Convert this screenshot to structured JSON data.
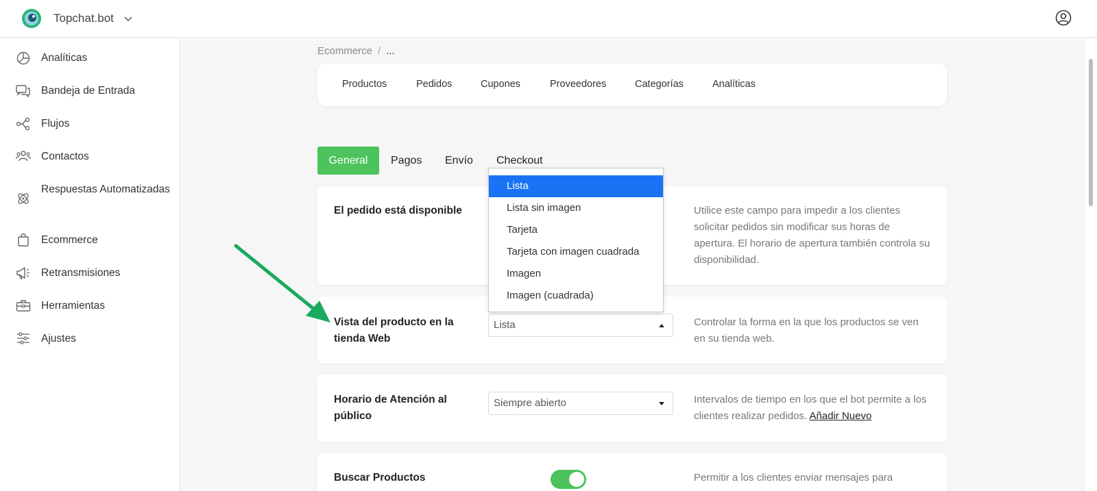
{
  "app": {
    "brand": "Topchat.bot"
  },
  "sidebar": {
    "items": [
      {
        "label": "Analíticas",
        "icon": "pie-chart-icon"
      },
      {
        "label": "Bandeja de Entrada",
        "icon": "chat-bubbles-icon"
      },
      {
        "label": "Flujos",
        "icon": "flow-nodes-icon"
      },
      {
        "label": "Contactos",
        "icon": "people-icon"
      },
      {
        "label": "Respuestas Automatizadas",
        "icon": "atom-icon"
      },
      {
        "label": "Ecommerce",
        "icon": "shopping-bag-icon"
      },
      {
        "label": "Retransmisiones",
        "icon": "megaphone-icon"
      },
      {
        "label": "Herramientas",
        "icon": "toolbox-icon"
      },
      {
        "label": "Ajustes",
        "icon": "sliders-icon"
      }
    ]
  },
  "breadcrumb": {
    "root": "Ecommerce",
    "separator": "/",
    "current": "..."
  },
  "toptabs": [
    "Productos",
    "Pedidos",
    "Cupones",
    "Proveedores",
    "Categorías",
    "Analíticas"
  ],
  "subtabs": {
    "items": [
      "General",
      "Pagos",
      "Envío",
      "Checkout"
    ],
    "active": "General"
  },
  "settings": {
    "order_available": {
      "label": "El pedido está disponible",
      "description": "Utilice este campo para impedir a los clientes solicitar pedidos sin modificar sus horas de apertura. El horario de apertura también controla su disponibilidad."
    },
    "product_view": {
      "label": "Vista del producto en la tienda Web",
      "value": "Lista",
      "description": "Controlar la forma en la que los productos se ven en su tienda web.",
      "options": [
        "Lista",
        "Lista sin imagen",
        "Tarjeta",
        "Tarjeta con imagen cuadrada",
        "Imagen",
        "Imagen (cuadrada)"
      ],
      "selected_option": "Lista"
    },
    "hours": {
      "label": "Horario de Atención al público",
      "value": "Siempre abierto",
      "description": "Intervalos de tiempo en los que el bot permite a los clientes realizar pedidos.",
      "link": "Añadir Nuevo"
    },
    "search_products": {
      "label": "Buscar Productos",
      "enabled": true,
      "description": "Permitir a los clientes enviar mensajes para"
    }
  },
  "colors": {
    "accent_green": "#4cc35c",
    "dropdown_selected": "#1a73f5",
    "annotation_arrow": "#1aaa5e"
  }
}
